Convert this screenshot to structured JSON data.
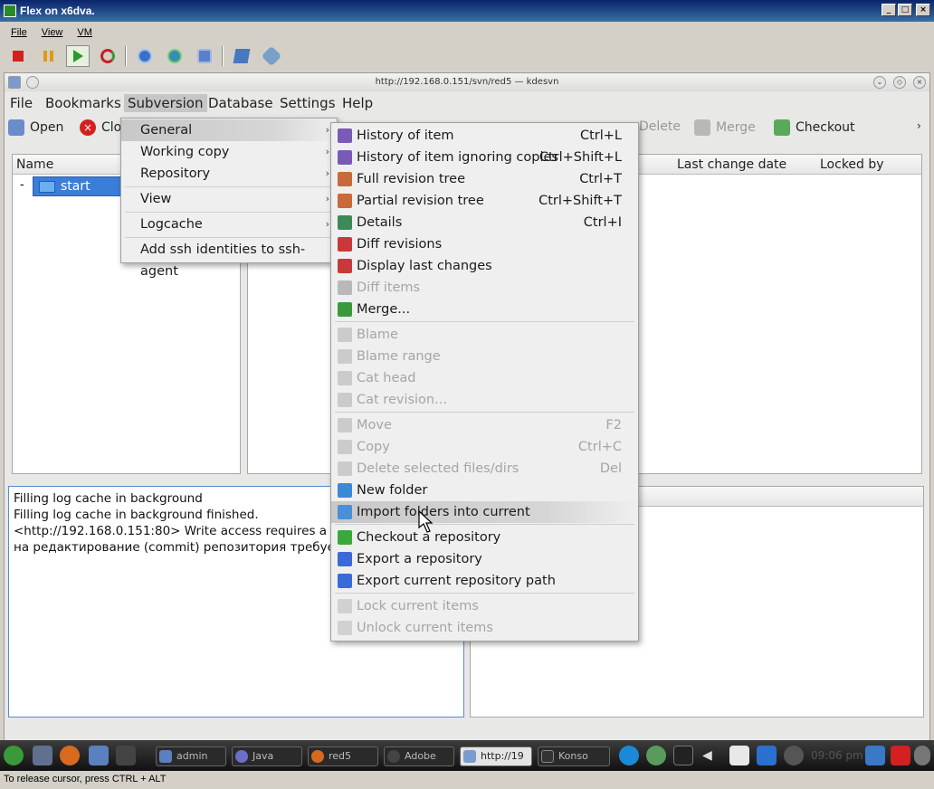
{
  "vm": {
    "title": "Flex on x6dva.",
    "menu": [
      "File",
      "View",
      "VM"
    ],
    "toolbar_icons": [
      "stop-icon",
      "pause-icon",
      "play-icon",
      "reset-icon",
      "snapshot-icon",
      "revert-icon",
      "manage-snapshots-icon",
      "settings-icon",
      "tools-icon"
    ],
    "status_text": "To release cursor, press CTRL + ALT"
  },
  "kde_window": {
    "title": "http://192.168.0.151/svn/red5 — kdesvn"
  },
  "app_menubar": [
    "File",
    "Bookmarks",
    "Subversion",
    "Database",
    "Settings",
    "Help"
  ],
  "toolbar": {
    "open": "Open",
    "close": "Clo",
    "delete": "Delete",
    "merge": "Merge",
    "checkout": "Checkout"
  },
  "tree": {
    "header": "Name",
    "item": "start",
    "expander": "-"
  },
  "detail_headers": {
    "last_change_date": "Last change date",
    "locked_by": "Locked by"
  },
  "log": {
    "lines": [
      "Filling log cache in background",
      "Filling log cache in background finished.",
      "<http://192.168.0.151:80> Write access requires a pas",
      "на редактирование (commit) репозитория требуетс"
    ]
  },
  "subversion_menu": {
    "items": [
      {
        "label": "General",
        "submenu": true,
        "highlighted": true
      },
      {
        "label": "Working copy",
        "submenu": true
      },
      {
        "label": "Repository",
        "submenu": true
      },
      {
        "label": "View",
        "submenu": true
      },
      {
        "label": "Logcache",
        "submenu": true
      },
      {
        "label": "Add ssh identities to ssh-agent",
        "submenu": false
      }
    ]
  },
  "general_submenu": {
    "items": [
      {
        "label": "History of item",
        "shortcut": "Ctrl+L",
        "icon": "history-icon",
        "enabled": true
      },
      {
        "label": "History of item ignoring copies",
        "shortcut": "Ctrl+Shift+L",
        "icon": "history-icon",
        "enabled": true
      },
      {
        "label": "Full revision tree",
        "shortcut": "Ctrl+T",
        "icon": "revision-tree-icon",
        "enabled": true
      },
      {
        "label": "Partial revision tree",
        "shortcut": "Ctrl+Shift+T",
        "icon": "revision-tree-icon",
        "enabled": true
      },
      {
        "label": "Details",
        "shortcut": "Ctrl+I",
        "icon": "details-icon",
        "enabled": true
      },
      {
        "label": "Diff revisions",
        "shortcut": "",
        "icon": "diff-icon",
        "enabled": true
      },
      {
        "label": "Display last changes",
        "shortcut": "",
        "icon": "diff-icon",
        "enabled": true
      },
      {
        "label": "Diff items",
        "shortcut": "",
        "icon": "diff-icon",
        "enabled": false
      },
      {
        "label": "Merge...",
        "shortcut": "",
        "icon": "merge-icon",
        "enabled": true
      },
      {
        "label": "Blame",
        "shortcut": "",
        "icon": "blame-icon",
        "enabled": false
      },
      {
        "label": "Blame range",
        "shortcut": "",
        "icon": "blame-icon",
        "enabled": false
      },
      {
        "label": "Cat head",
        "shortcut": "",
        "icon": "cat-icon",
        "enabled": false
      },
      {
        "label": "Cat revision...",
        "shortcut": "",
        "icon": "cat-icon",
        "enabled": false
      },
      {
        "label": "Move",
        "shortcut": "F2",
        "icon": "move-icon",
        "enabled": false
      },
      {
        "label": "Copy",
        "shortcut": "Ctrl+C",
        "icon": "copy-icon",
        "enabled": false
      },
      {
        "label": "Delete selected files/dirs",
        "shortcut": "Del",
        "icon": "delete-icon",
        "enabled": false
      },
      {
        "label": "New folder",
        "shortcut": "",
        "icon": "new-folder-icon",
        "enabled": true
      },
      {
        "label": "Import folders into current",
        "shortcut": "",
        "icon": "import-icon",
        "enabled": true,
        "highlighted": true
      },
      {
        "label": "Checkout a repository",
        "shortcut": "",
        "icon": "checkout-icon",
        "enabled": true
      },
      {
        "label": "Export a repository",
        "shortcut": "",
        "icon": "export-icon",
        "enabled": true
      },
      {
        "label": "Export current repository path",
        "shortcut": "",
        "icon": "export-icon",
        "enabled": true
      },
      {
        "label": "Lock current items",
        "shortcut": "",
        "icon": "lock-icon",
        "enabled": false
      },
      {
        "label": "Unlock current items",
        "shortcut": "",
        "icon": "unlock-icon",
        "enabled": false
      }
    ]
  },
  "taskbar": {
    "tasks": [
      "admin",
      "Java",
      "red5",
      "Adobe",
      "http://19",
      "Konso"
    ],
    "clock": "09:06 pm"
  },
  "colors": {
    "highlight_blue": "#3b7ed8",
    "menu_bg": "#efefef",
    "disabled_text": "#a5a5a5",
    "taskbar_bg": "#1c1c1c"
  }
}
